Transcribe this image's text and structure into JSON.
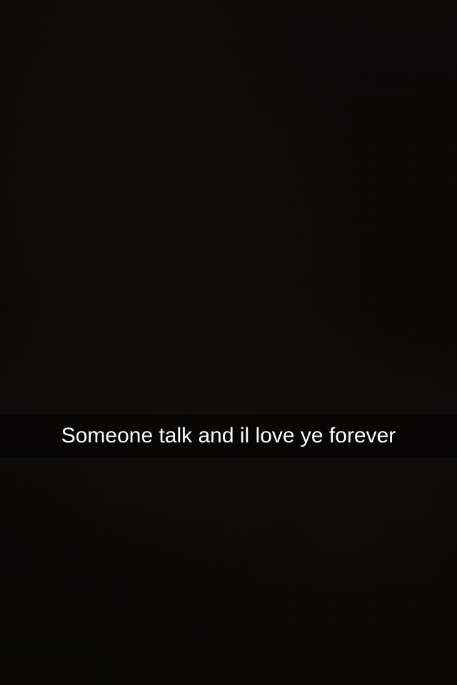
{
  "caption": {
    "text": "Someone talk and il love ye forever"
  },
  "colors": {
    "background": "#0b0a09",
    "caption_text": "#ffffff",
    "caption_bar": "rgba(0,0,0,0.55)"
  }
}
